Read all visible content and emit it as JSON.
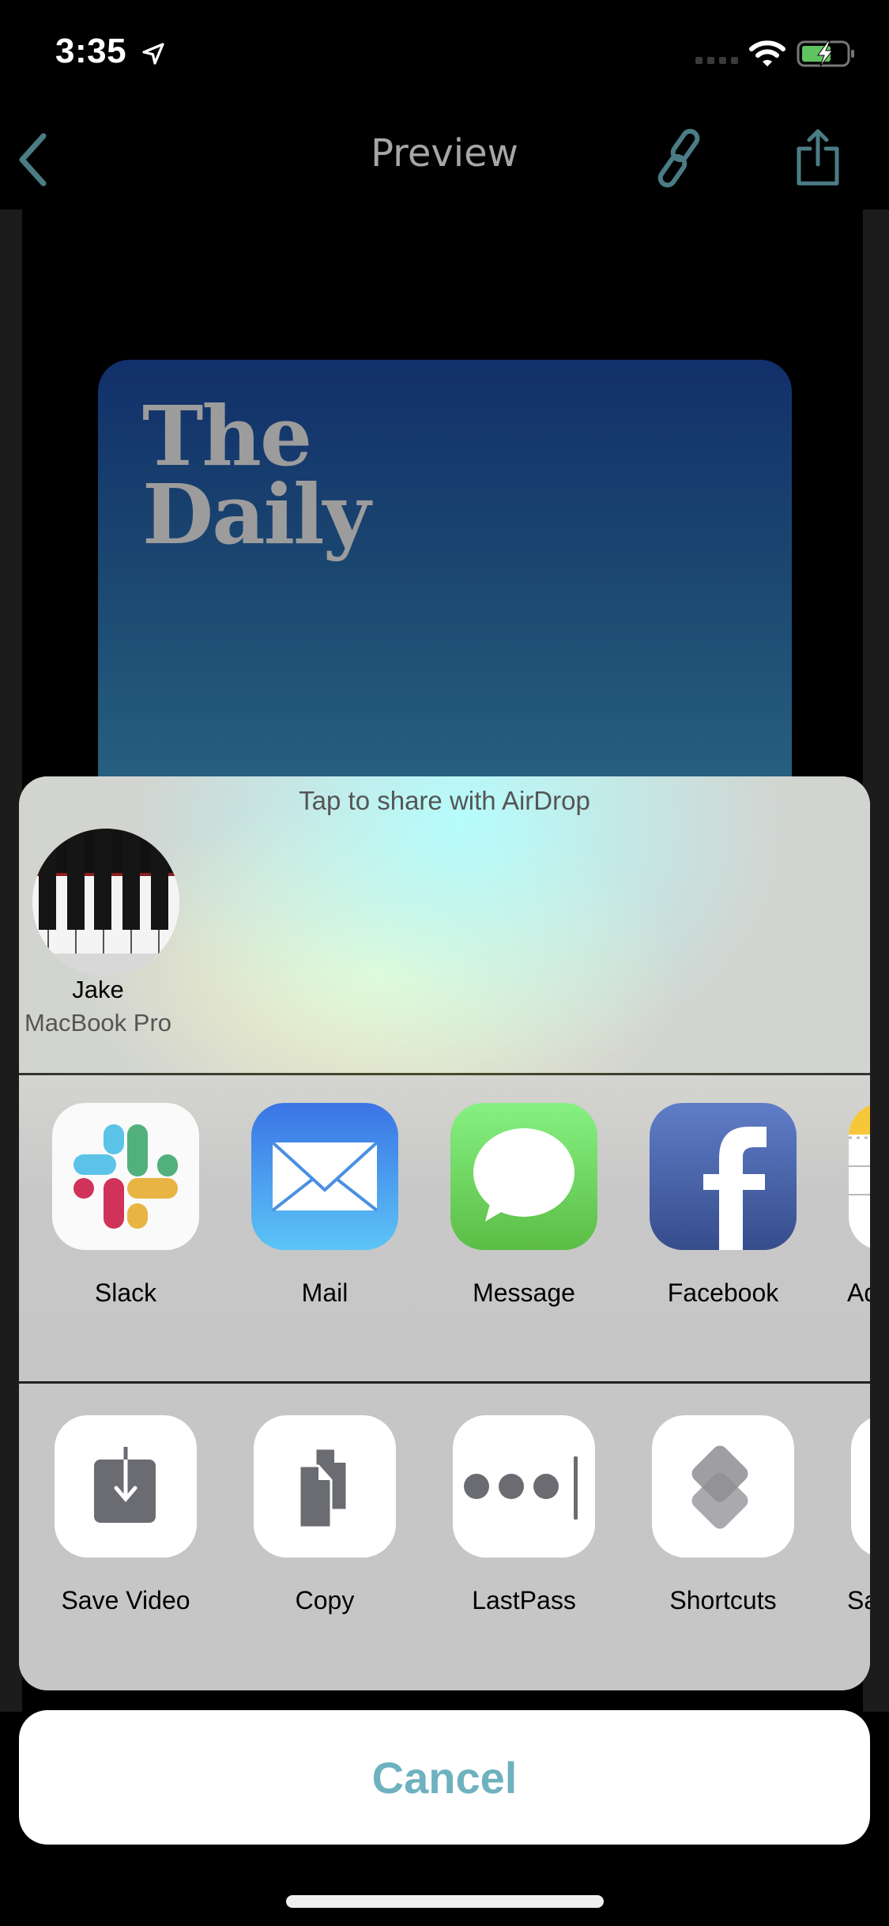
{
  "status_bar": {
    "time": "3:35",
    "location_icon": "location-arrow-icon",
    "signal_icon": "cellular-signal-icon",
    "wifi_icon": "wifi-icon",
    "battery_icon": "battery-charging-icon"
  },
  "nav": {
    "title": "Preview",
    "back_icon": "chevron-left-icon",
    "link_icon": "link-icon",
    "share_icon": "share-icon",
    "accent_color": "#4b7c85"
  },
  "preview": {
    "artwork_title_line1": "The",
    "artwork_title_line2": "Daily"
  },
  "share_sheet": {
    "airdrop_hint": "Tap to share with AirDrop",
    "airdrop_targets": [
      {
        "name": "Jake",
        "device": "MacBook Pro",
        "avatar": "piano-keys-avatar"
      }
    ],
    "apps": [
      {
        "label": "Slack",
        "icon": "slack-icon"
      },
      {
        "label": "Mail",
        "icon": "mail-icon"
      },
      {
        "label": "Message",
        "icon": "messages-icon"
      },
      {
        "label": "Facebook",
        "icon": "facebook-icon"
      },
      {
        "label": "Ad",
        "icon": "notes-icon"
      }
    ],
    "actions": [
      {
        "label": "Save Video",
        "icon": "save-video-icon"
      },
      {
        "label": "Copy",
        "icon": "copy-icon"
      },
      {
        "label": "LastPass",
        "icon": "lastpass-icon"
      },
      {
        "label": "Shortcuts",
        "icon": "shortcuts-icon"
      },
      {
        "label": "Sa",
        "icon": "action-icon"
      }
    ]
  },
  "cancel": {
    "label": "Cancel",
    "color": "#6eb1bf"
  }
}
